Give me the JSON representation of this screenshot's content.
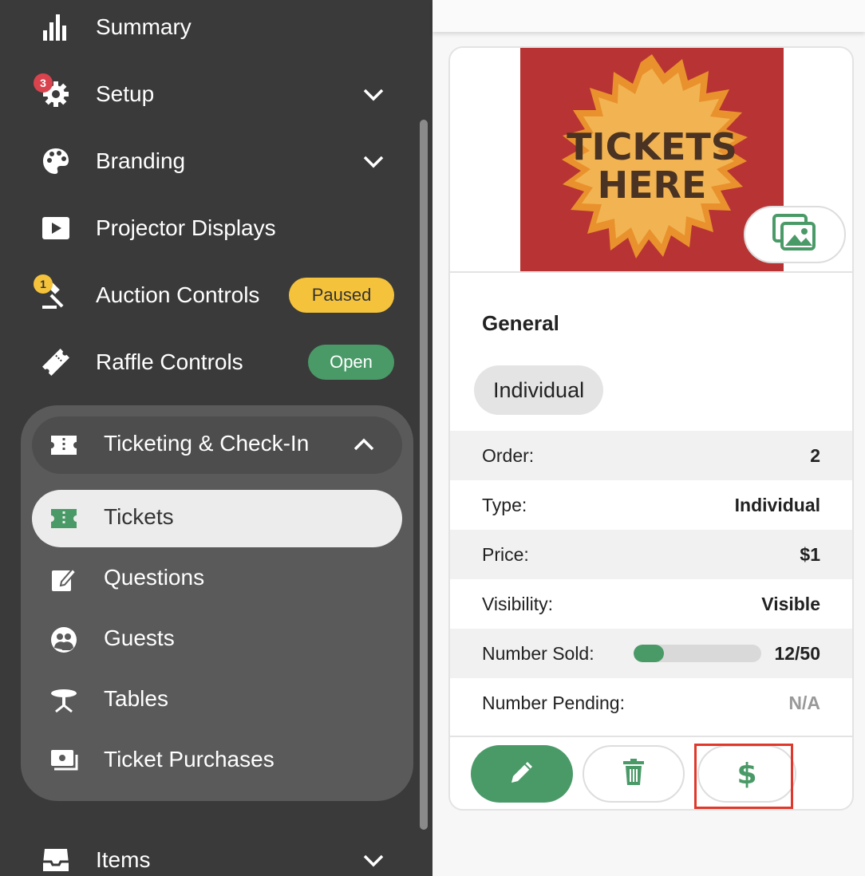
{
  "sidebar": {
    "items": [
      {
        "label": "Summary",
        "icon": "bar-chart-icon"
      },
      {
        "label": "Setup",
        "icon": "gear-icon",
        "badge": "3"
      },
      {
        "label": "Branding",
        "icon": "palette-icon"
      },
      {
        "label": "Projector Displays",
        "icon": "play-icon"
      },
      {
        "label": "Auction Controls",
        "icon": "gavel-icon",
        "badge": "1",
        "status": "Paused"
      },
      {
        "label": "Raffle Controls",
        "icon": "raffle-ticket-icon",
        "status": "Open"
      },
      {
        "label": "Items",
        "icon": "inbox-icon"
      }
    ],
    "group": {
      "label": "Ticketing & Check-In",
      "items": [
        {
          "label": "Tickets",
          "icon": "ticket-icon",
          "active": true
        },
        {
          "label": "Questions",
          "icon": "edit-icon"
        },
        {
          "label": "Guests",
          "icon": "guests-icon"
        },
        {
          "label": "Tables",
          "icon": "table-icon"
        },
        {
          "label": "Ticket Purchases",
          "icon": "purchases-icon"
        }
      ]
    }
  },
  "card": {
    "image_text_line1": "TICKETS",
    "image_text_line2": "HERE",
    "name": "General",
    "type_chip": "Individual",
    "rows": {
      "order": {
        "label": "Order:",
        "value": "2"
      },
      "type": {
        "label": "Type:",
        "value": "Individual"
      },
      "price": {
        "label": "Price:",
        "value": "$1"
      },
      "visibility": {
        "label": "Visibility:",
        "value": "Visible"
      },
      "sold": {
        "label": "Number Sold:",
        "value": "12/50",
        "progress": 0.24
      },
      "pending": {
        "label": "Number Pending:",
        "value": "N/A"
      }
    },
    "actions": {
      "price_symbol": "$"
    }
  },
  "colors": {
    "sidebar_bg": "#3a3a3a",
    "accent_green": "#4a9a68",
    "paused_yellow": "#f5c33b",
    "open_green": "#4a9a68",
    "highlight_red": "#e0392b",
    "badge_red": "#d9434e"
  }
}
